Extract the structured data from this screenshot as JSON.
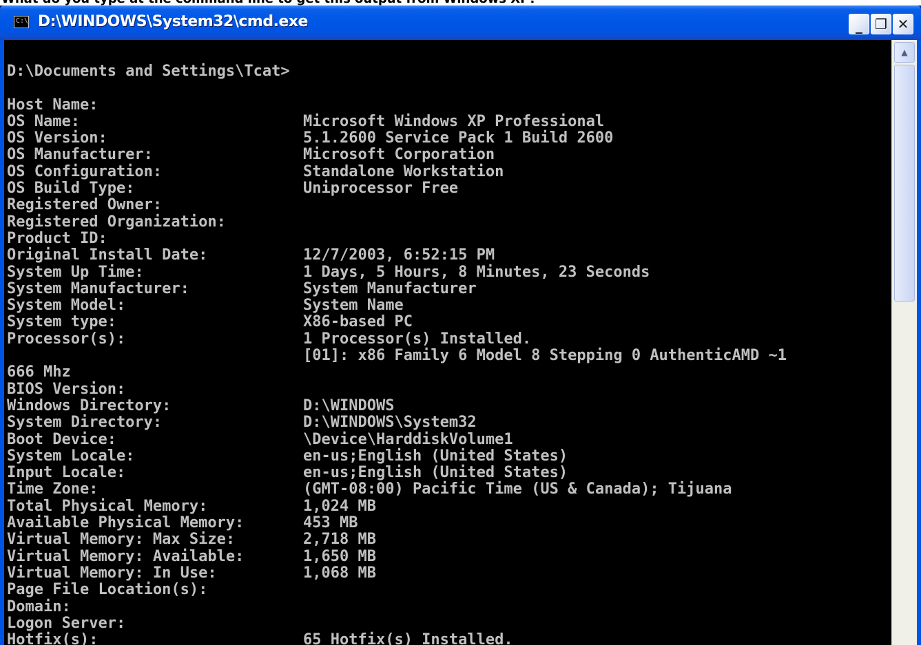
{
  "caption": "What do you type at the command line to get this output from Windows XP?",
  "window": {
    "title": "D:\\WINDOWS\\System32\\cmd.exe",
    "icon_name": "cmd-icon",
    "icon_glyph": "C:\\",
    "minimize_glyph": "_",
    "maximize_glyph": "❐",
    "close_glyph": "✕"
  },
  "scrollbar": {
    "up_glyph": "▲",
    "position_fraction": 0.0
  },
  "console": {
    "prompt": "D:\\Documents and Settings\\Tcat>",
    "entries": [
      {
        "key": "Host Name:",
        "value": ""
      },
      {
        "key": "OS Name:",
        "value": "Microsoft Windows XP Professional"
      },
      {
        "key": "OS Version:",
        "value": "5.1.2600 Service Pack 1 Build 2600"
      },
      {
        "key": "OS Manufacturer:",
        "value": "Microsoft Corporation"
      },
      {
        "key": "OS Configuration:",
        "value": "Standalone Workstation"
      },
      {
        "key": "OS Build Type:",
        "value": "Uniprocessor Free"
      },
      {
        "key": "Registered Owner:",
        "value": ""
      },
      {
        "key": "Registered Organization:",
        "value": ""
      },
      {
        "key": "Product ID:",
        "value": ""
      },
      {
        "key": "Original Install Date:",
        "value": "12/7/2003, 6:52:15 PM"
      },
      {
        "key": "System Up Time:",
        "value": "1 Days, 5 Hours, 8 Minutes, 23 Seconds"
      },
      {
        "key": "System Manufacturer:",
        "value": "System Manufacturer"
      },
      {
        "key": "System Model:",
        "value": "System Name"
      },
      {
        "key": "System type:",
        "value": "X86-based PC"
      },
      {
        "key": "Processor(s):",
        "value": "1 Processor(s) Installed."
      },
      {
        "key": "",
        "value": "[01]: x86 Family 6 Model 8 Stepping 0 AuthenticAMD ~1"
      },
      {
        "key": "666 Mhz",
        "value": ""
      },
      {
        "key": "BIOS Version:",
        "value": ""
      },
      {
        "key": "Windows Directory:",
        "value": "D:\\WINDOWS"
      },
      {
        "key": "System Directory:",
        "value": "D:\\WINDOWS\\System32"
      },
      {
        "key": "Boot Device:",
        "value": "\\Device\\HarddiskVolume1"
      },
      {
        "key": "System Locale:",
        "value": "en-us;English (United States)"
      },
      {
        "key": "Input Locale:",
        "value": "en-us;English (United States)"
      },
      {
        "key": "Time Zone:",
        "value": "(GMT-08:00) Pacific Time (US & Canada); Tijuana"
      },
      {
        "key": "Total Physical Memory:",
        "value": "1,024 MB"
      },
      {
        "key": "Available Physical Memory:",
        "value": "453 MB"
      },
      {
        "key": "Virtual Memory: Max Size:",
        "value": "2,718 MB"
      },
      {
        "key": "Virtual Memory: Available:",
        "value": "1,650 MB"
      },
      {
        "key": "Virtual Memory: In Use:",
        "value": "1,068 MB"
      },
      {
        "key": "Page File Location(s):",
        "value": ""
      },
      {
        "key": "Domain:",
        "value": ""
      },
      {
        "key": "Logon Server:",
        "value": ""
      },
      {
        "key": "Hotfix(s):",
        "value": "65 Hotfix(s) Installed."
      }
    ]
  },
  "colors": {
    "console_bg": "#000000",
    "console_fg": "#c0c0c0",
    "titlebar": "#0054e3"
  }
}
